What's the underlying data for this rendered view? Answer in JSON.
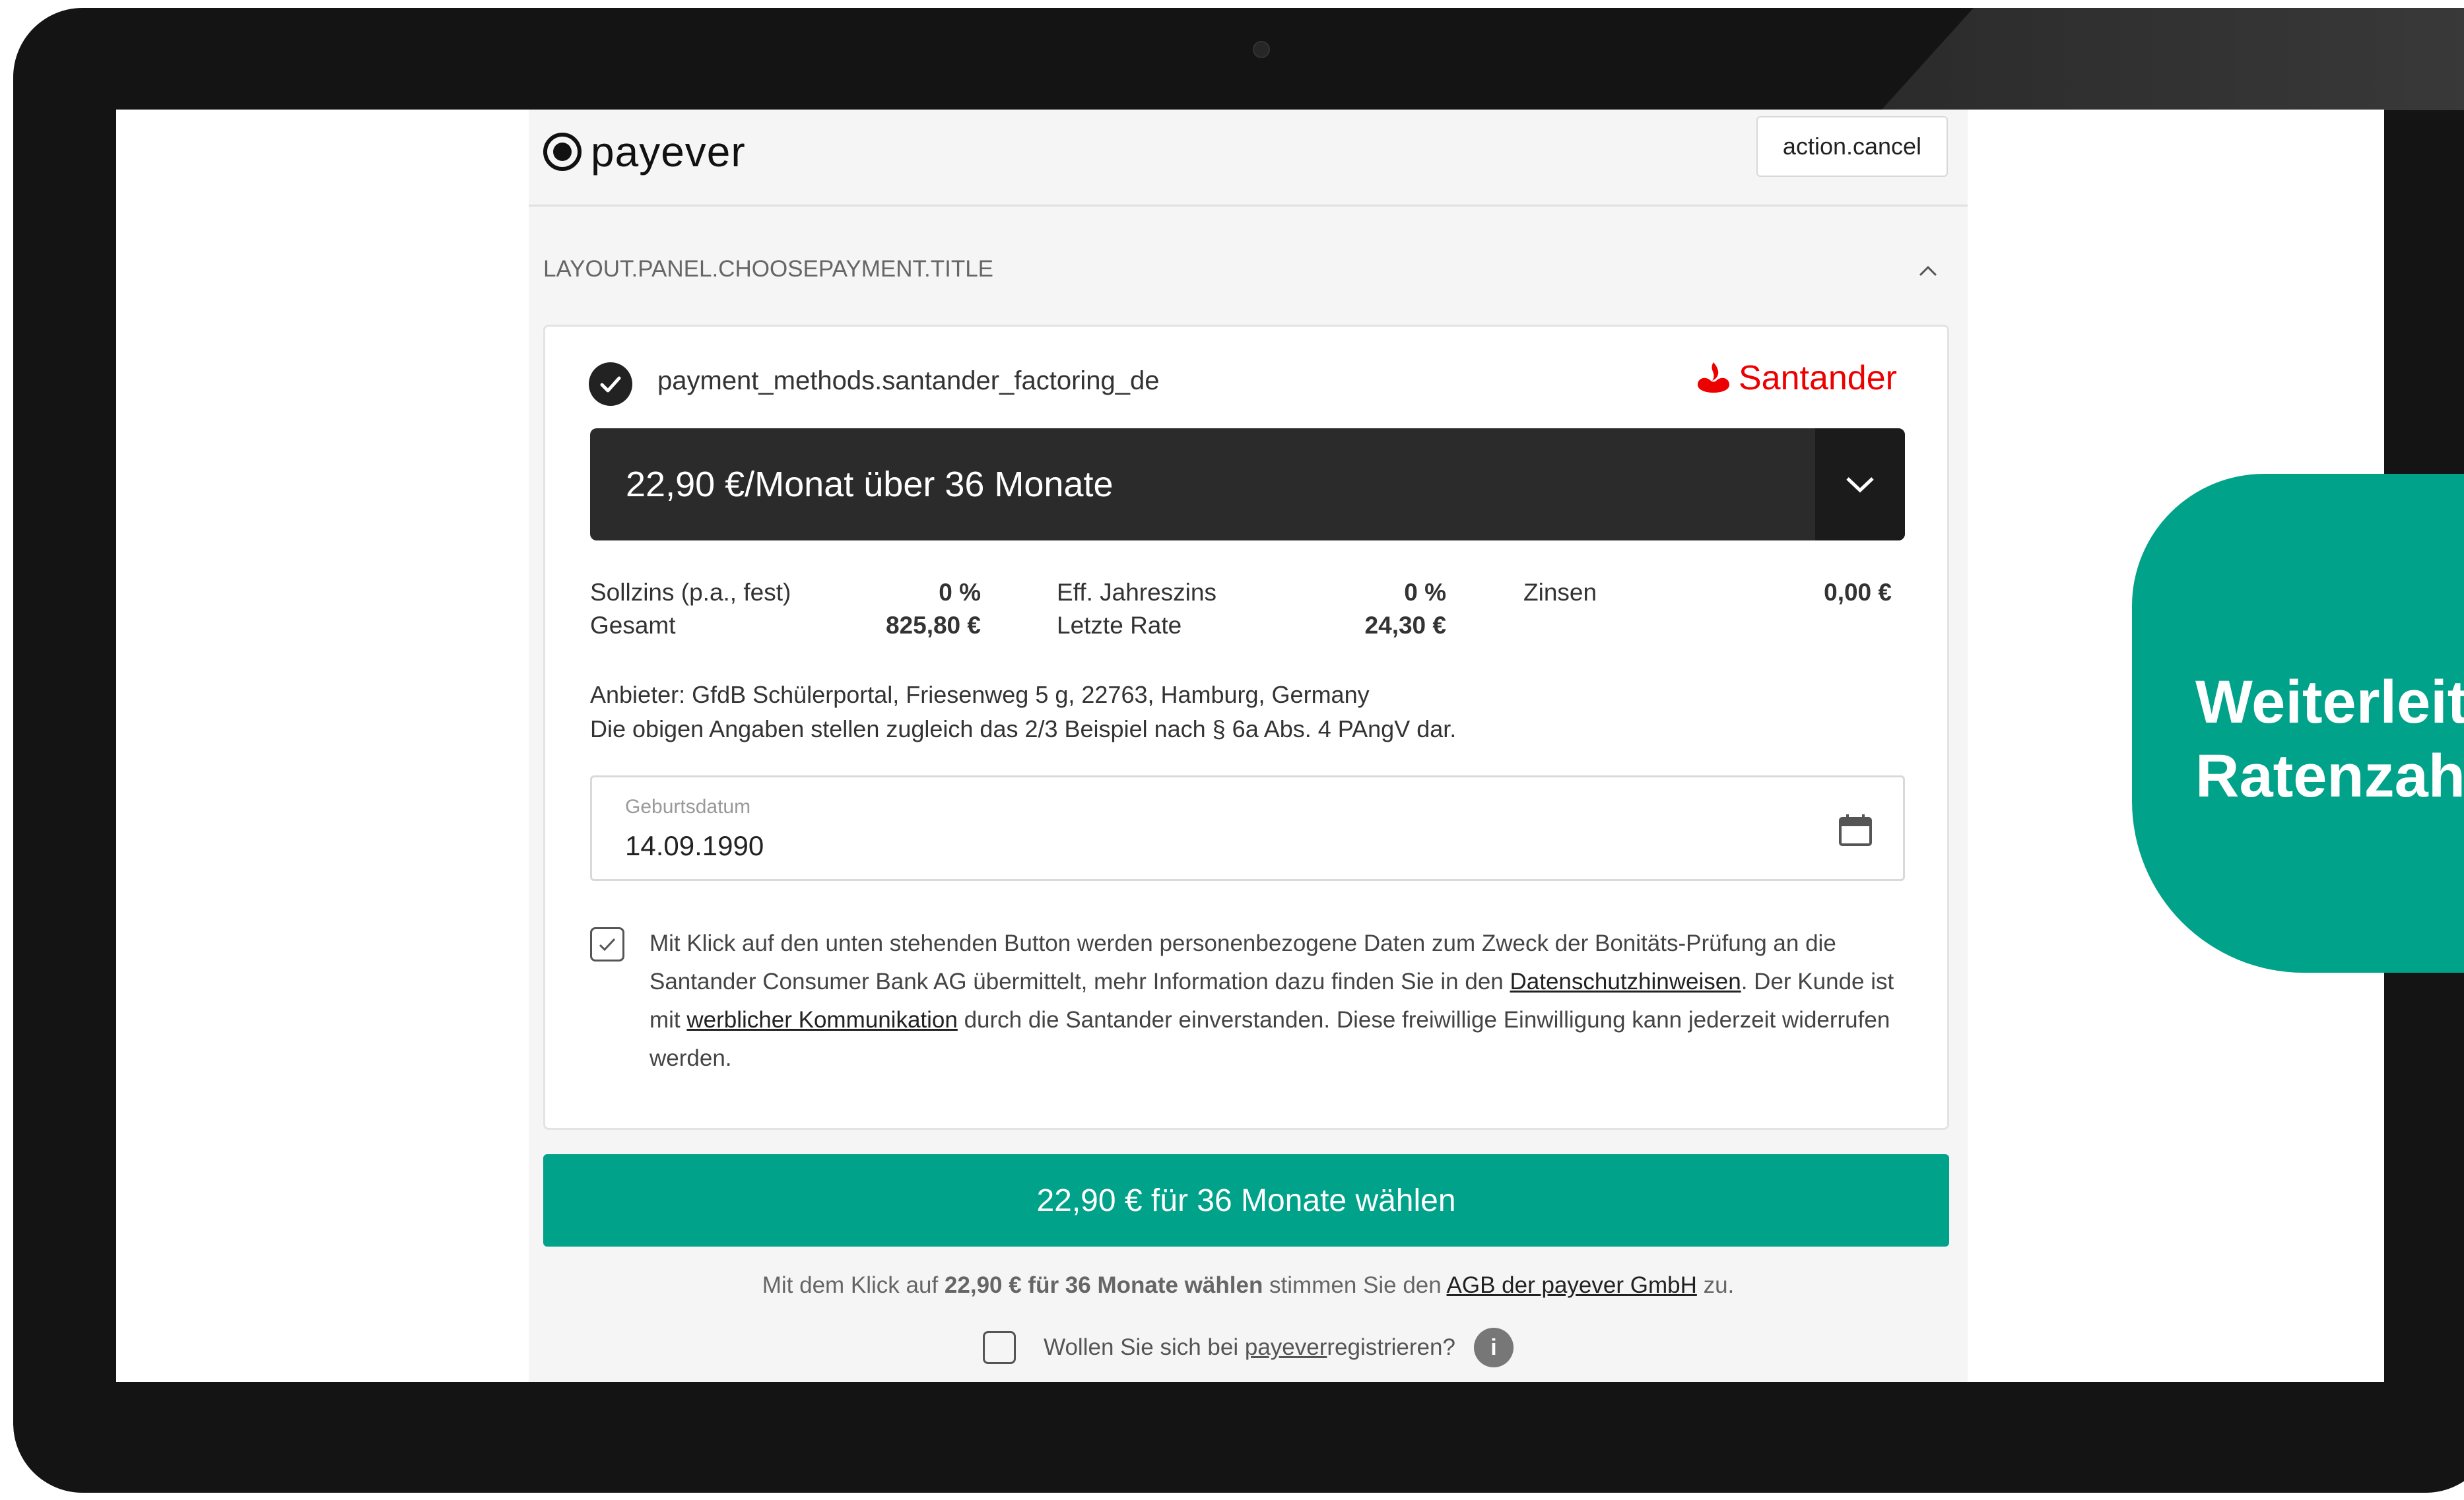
{
  "header": {
    "logo_text": "payever",
    "cancel_label": "action.cancel"
  },
  "section": {
    "title": "LAYOUT.PANEL.CHOOSEPAYMENT.TITLE"
  },
  "payment": {
    "method_name": "payment_methods.santander_factoring_de",
    "provider_logo_text": "Santander",
    "selected_rate": "22,90 €/Monat über 36 Monate",
    "financing": {
      "rows": [
        [
          {
            "label": "Sollzins (p.a., fest)",
            "value": "0 %"
          },
          {
            "label": "Eff. Jahreszins",
            "value": "0 %"
          },
          {
            "label": "Zinsen",
            "value": "0,00 €"
          }
        ],
        [
          {
            "label": "Gesamt",
            "value": "825,80 €"
          },
          {
            "label": "Letzte Rate",
            "value": "24,30 €"
          }
        ]
      ]
    },
    "provider_line1": "Anbieter: GfdB Schülerportal, Friesenweg 5 g, 22763, Hamburg, Germany",
    "provider_line2": "Die obigen Angaben stellen zugleich das 2/3 Beispiel nach § 6a Abs. 4 PAngV dar.",
    "birthdate": {
      "label": "Geburtsdatum",
      "value": "14.09.1990"
    },
    "consent": {
      "checked": true,
      "part1": "Mit Klick auf den unten stehenden Button werden personenbezogene Daten zum Zweck der Bonitäts-Prüfung an die Santander Consumer Bank AG übermittelt, mehr Information dazu finden Sie in den ",
      "link1": "Datenschutzhinweisen",
      "part2": ". Der Kunde ist mit ",
      "link2": "werblicher Kommunikation",
      "part3": " durch die Santander einverstanden. Diese freiwillige Einwilligung kann jederzeit widerrufen werden."
    }
  },
  "submit": {
    "label": "22,90 € für 36 Monate wählen"
  },
  "terms": {
    "prefix": "Mit dem Klick auf ",
    "bold": "22,90 € für 36 Monate wählen",
    "middle": " stimmen Sie den ",
    "link": "AGB der payever GmbH",
    "suffix": " zu."
  },
  "register": {
    "prefix": "Wollen Sie sich bei ",
    "link": "payever",
    "suffix": " registrieren?",
    "info": "i"
  },
  "callout": {
    "line1": "Weiterleit",
    "line2": "Ratenzah"
  },
  "colors": {
    "accent": "#00a38a",
    "santander_red": "#ec0000",
    "dark_select": "#2b2b2b"
  }
}
